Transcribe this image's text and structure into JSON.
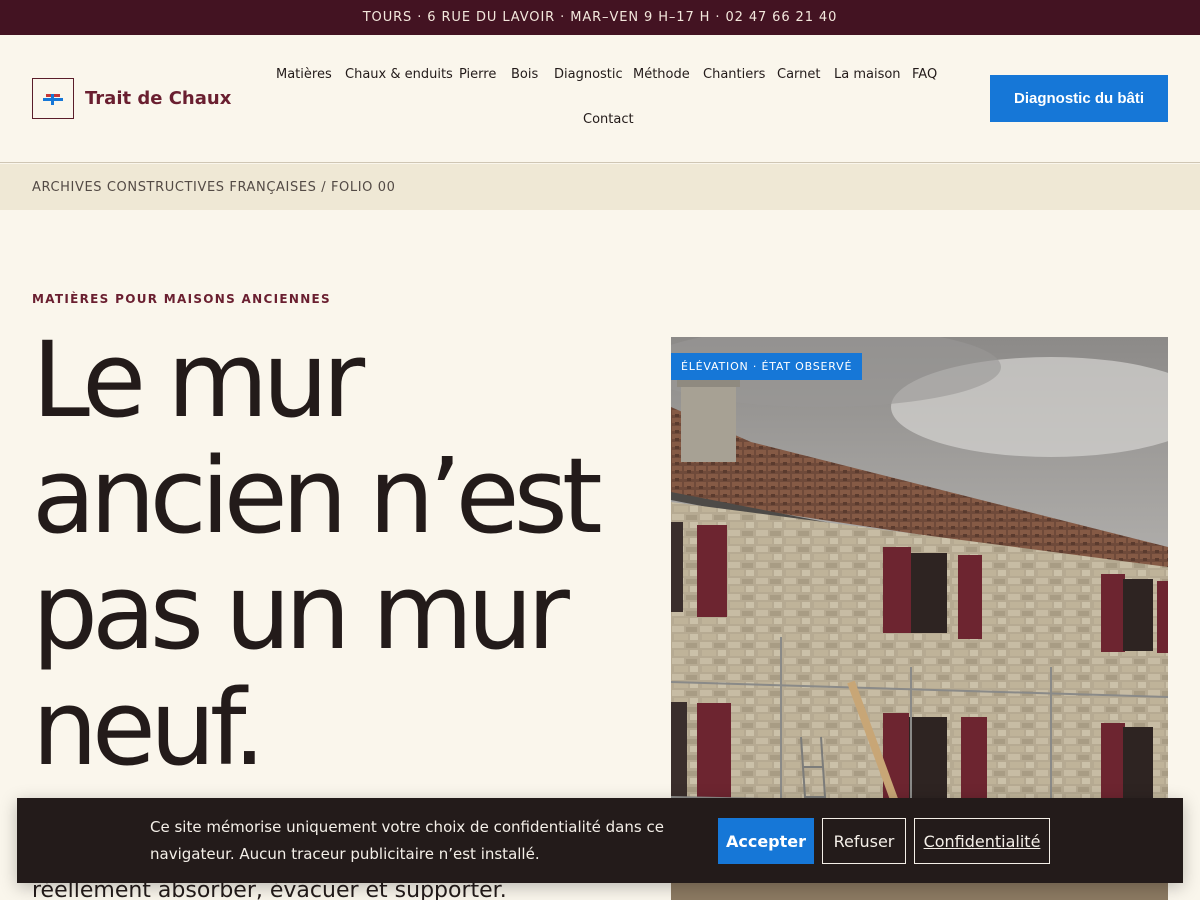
{
  "topbar": {
    "text": "TOURS · 6 RUE DU LAVOIR · MAR–VEN 9 H–17 H · 02 47 66 21 40"
  },
  "brand": {
    "name": "Trait de Chaux",
    "colors": {
      "primary": "#6a1f30",
      "accent": "#1677d7",
      "dark": "#231b1a"
    }
  },
  "nav": {
    "items": [
      {
        "label": "Matières"
      },
      {
        "label": "Chaux & enduits"
      },
      {
        "label": "Pierre"
      },
      {
        "label": "Bois"
      },
      {
        "label": "Diagnostic"
      },
      {
        "label": "Méthode"
      },
      {
        "label": "Chantiers"
      },
      {
        "label": "Carnet"
      },
      {
        "label": "La maison"
      },
      {
        "label": "FAQ"
      },
      {
        "label": "Contact"
      }
    ]
  },
  "cta": {
    "label": "Diagnostic du bâti"
  },
  "breadcrumb": {
    "text": "ARCHIVES CONSTRUCTIVES FRANÇAISES / FOLIO 00"
  },
  "hero": {
    "eyebrow": "MATIÈRES POUR MAISONS ANCIENNES",
    "title_lines": [
      "Le mur",
      "ancien n’est",
      "pas un mur",
      "neuf."
    ],
    "body_partial": "réellement absorber, évacuer et supporter.",
    "image_badge": "ÉLÉVATION · ÉTAT OBSERVÉ"
  },
  "cookie": {
    "text": "Ce site mémorise uniquement votre choix de confidentialité dans ce navigateur. Aucun traceur publicitaire n’est installé.",
    "accept": "Accepter",
    "refuse": "Refuser",
    "privacy": "Confidentialité"
  },
  "icons": {
    "logo": "trowel-mark-icon"
  }
}
